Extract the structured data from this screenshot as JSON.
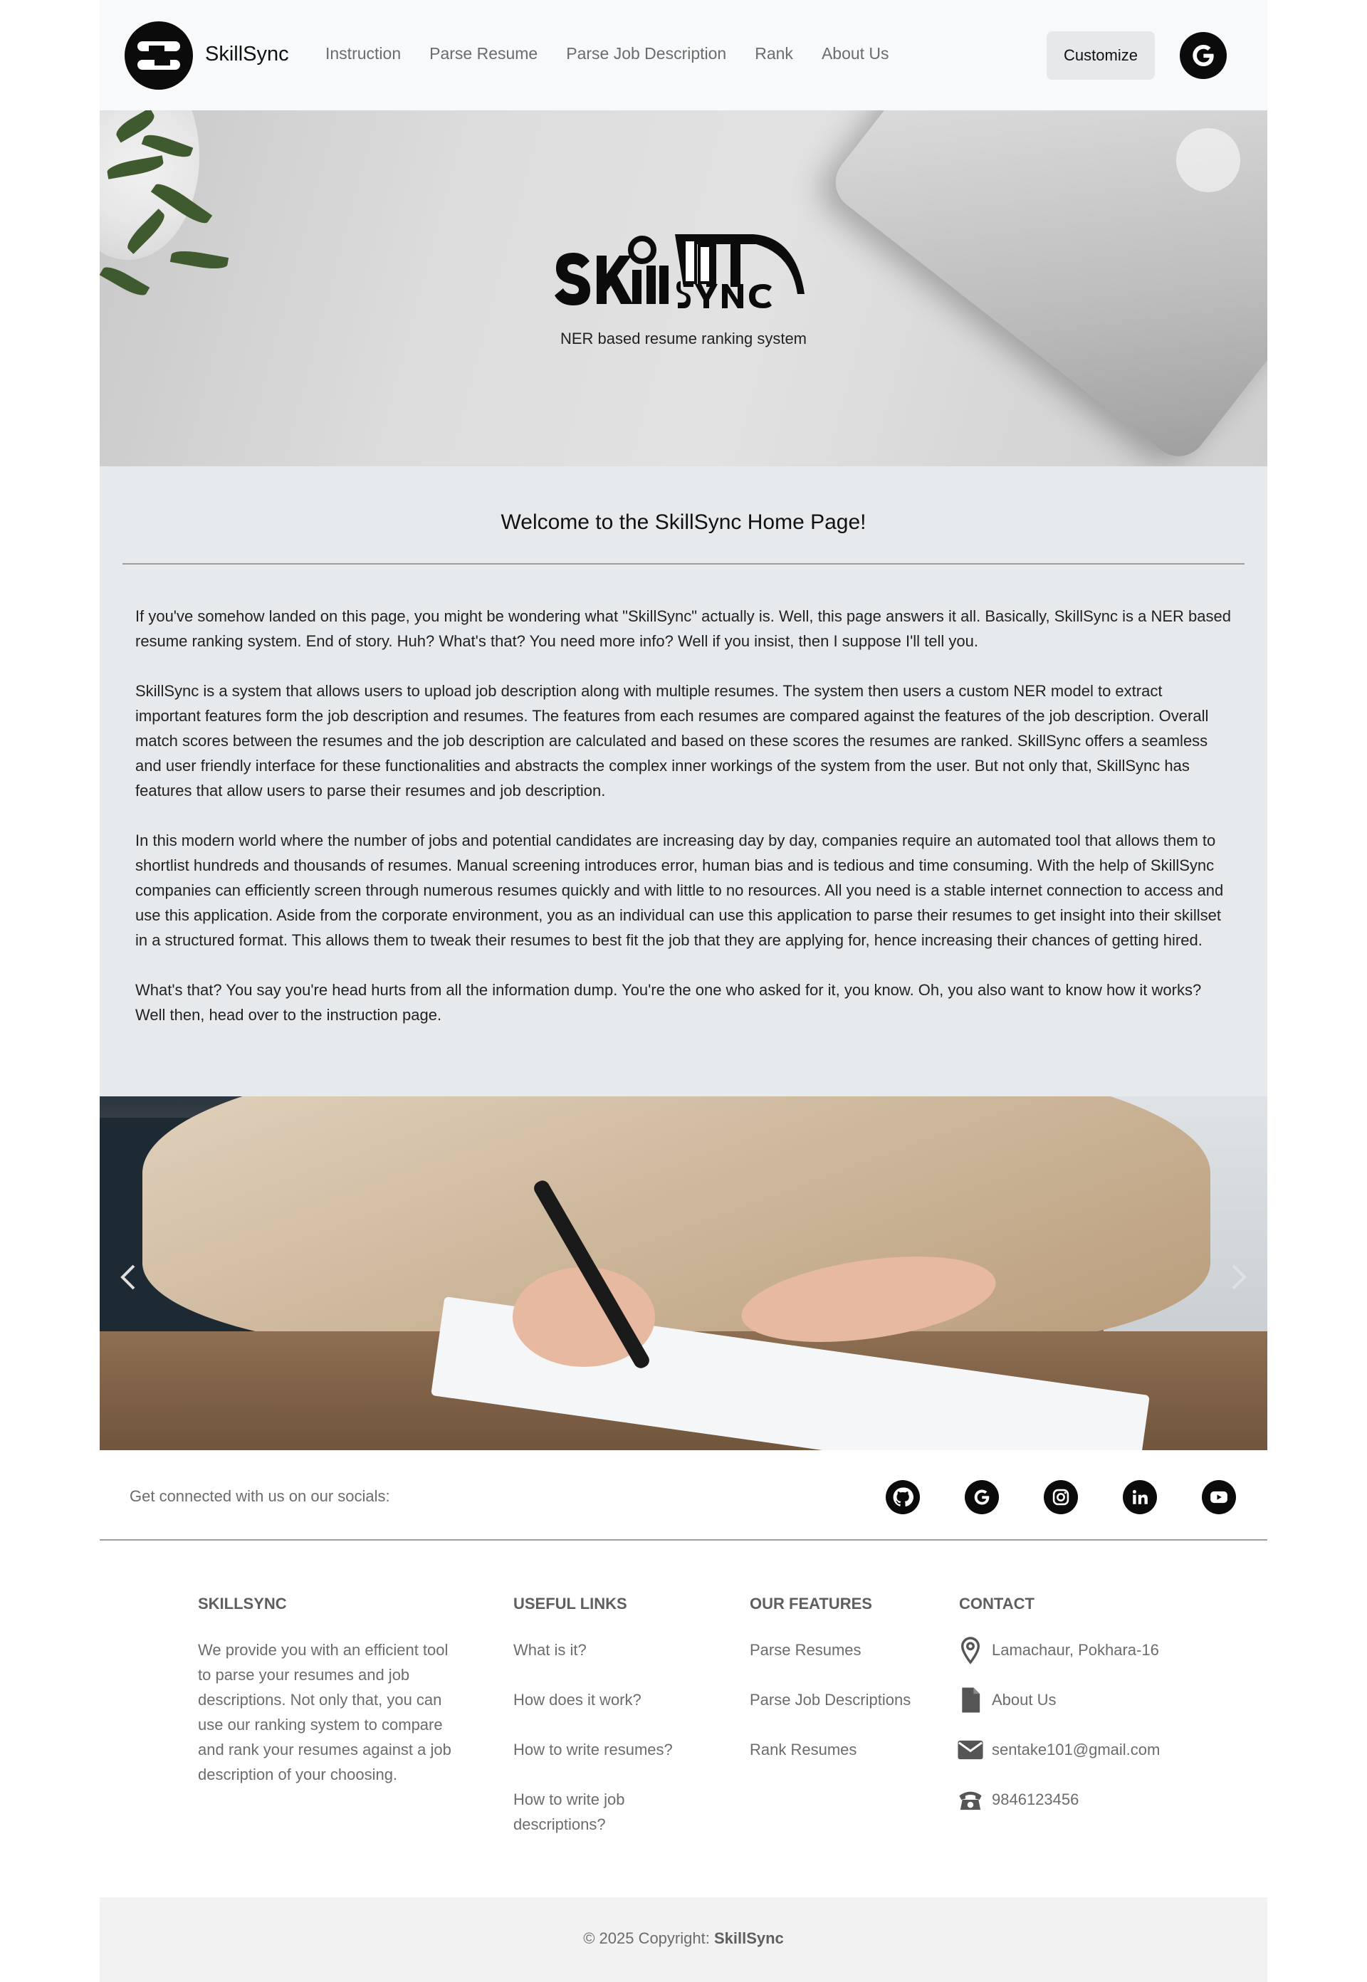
{
  "navbar": {
    "brand": "SkillSync",
    "links": [
      "Instruction",
      "Parse Resume",
      "Parse Job Description",
      "Rank",
      "About Us"
    ],
    "customize_label": "Customize",
    "login_icon": "google-icon"
  },
  "hero": {
    "logo_text": "SkillSync",
    "tagline": "NER based resume ranking system"
  },
  "welcome": {
    "title": "Welcome to the SkillSync Home Page!",
    "paragraphs": [
      "If you've somehow landed on this page, you might be wondering what \"SkillSync\" actually is. Well, this page answers it all. Basically, SkillSync is a NER based resume ranking system. End of story. Huh? What's that? You need more info? Well if you insist, then I suppose I'll tell you.",
      "SkillSync is a system that allows users to upload job description along with multiple resumes. The system then users a custom NER model to extract important features form the job description and resumes. The features from each resumes are compared against the features of the job description. Overall match scores between the resumes and the job description are calculated and based on these scores the resumes are ranked. SkillSync offers a seamless and user friendly interface for these functionalities and abstracts the complex inner workings of the system from the user. But not only that, SkillSync has features that allow users to parse their resumes and job description.",
      "In this modern world where the number of jobs and potential candidates are increasing day by day, companies require an automated tool that allows them to shortlist hundreds and thousands of resumes. Manual screening introduces error, human bias and is tedious and time consuming. With the help of SkillSync companies can efficiently screen through numerous resumes quickly and with little to no resources. All you need is a stable internet connection to access and use this application. Aside from the corporate environment, you as an individual can use this application to parse their resumes to get insight into their skillset in a structured format. This allows them to tweak their resumes to best fit the job that they are applying for, hence increasing their chances of getting hired.",
      "What's that? You say you're head hurts from all the information dump. You're the one who asked for it, you know. Oh, you also want to know how it works? Well then, head over to the instruction page."
    ]
  },
  "carousel": {
    "prev_icon": "chevron-left-icon",
    "next_icon": "chevron-right-icon"
  },
  "social": {
    "text": "Get connected with us on our socials:",
    "icons": [
      "github-icon",
      "google-icon",
      "instagram-icon",
      "linkedin-icon",
      "youtube-icon"
    ]
  },
  "footer": {
    "about": {
      "heading": "SkillSync",
      "text": "We provide you with an efficient tool to parse your resumes and job descriptions. Not only that, you can use our ranking system to compare and rank your resumes against a job description of your choosing."
    },
    "useful_links": {
      "heading": "Useful links",
      "items": [
        "What is it?",
        "How does it work?",
        "How to write resumes?",
        "How to write job descriptions?"
      ]
    },
    "features": {
      "heading": "Our Features",
      "items": [
        "Parse Resumes",
        "Parse Job Descriptions",
        "Rank Resumes"
      ]
    },
    "contact": {
      "heading": "Contact",
      "items": [
        {
          "icon": "map-pin-icon",
          "text": "Lamachaur, Pokhara-16"
        },
        {
          "icon": "document-icon",
          "text": "About Us"
        },
        {
          "icon": "envelope-icon",
          "text": "sentake101@gmail.com"
        },
        {
          "icon": "phone-icon",
          "text": "9846123456"
        }
      ]
    }
  },
  "copyright": {
    "prefix": "© 2025 Copyright: ",
    "brand": "SkillSync"
  }
}
